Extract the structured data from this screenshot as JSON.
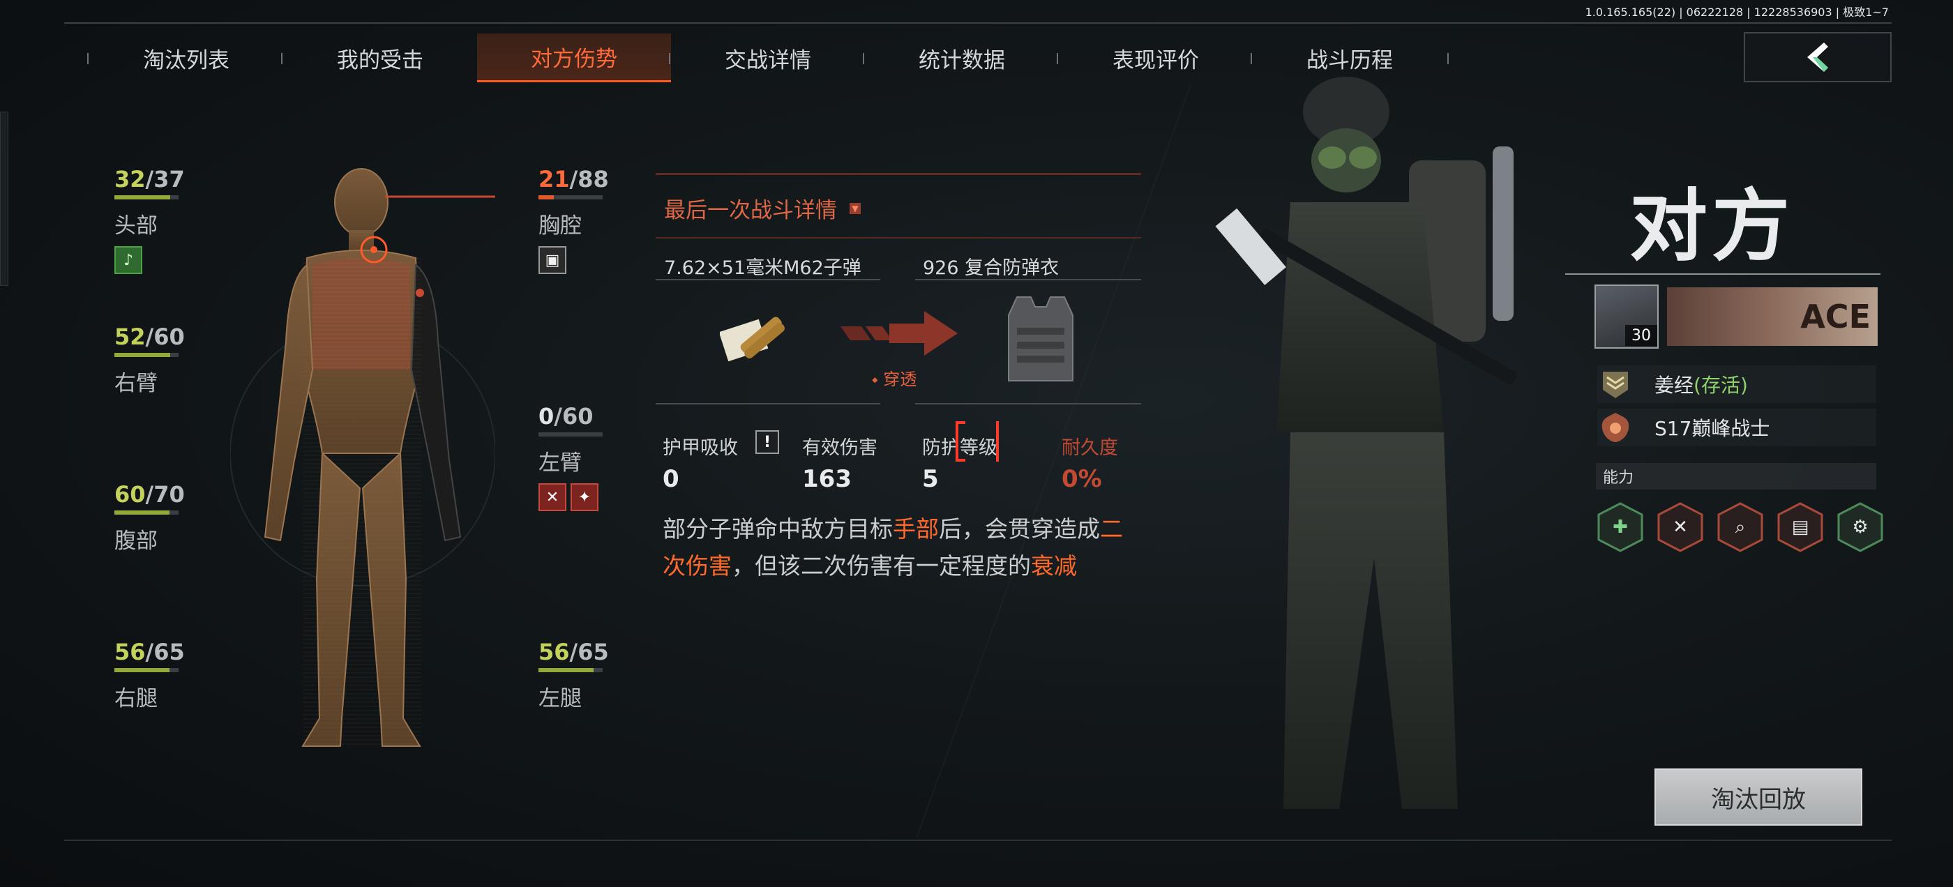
{
  "version": "1.0.165.165(22) | 06222128 | 12228536903 | 极致1~7",
  "tabs": [
    {
      "label": "淘汰列表",
      "active": false
    },
    {
      "label": "我的受击",
      "active": false
    },
    {
      "label": "对方伤势",
      "active": true
    },
    {
      "label": "交战详情",
      "active": false
    },
    {
      "label": "统计数据",
      "active": false
    },
    {
      "label": "表现评价",
      "active": false
    },
    {
      "label": "战斗历程",
      "active": false
    }
  ],
  "body_parts": {
    "head": {
      "current": "32",
      "max": "/37",
      "name": "头部",
      "fraction": 0.865
    },
    "chest": {
      "current": "21",
      "max": "/88",
      "name": "胸腔",
      "fraction": 0.239
    },
    "right_arm": {
      "current": "52",
      "max": "/60",
      "name": "右臂",
      "fraction": 0.867
    },
    "left_arm": {
      "current": "0",
      "max": "/60",
      "name": "左臂",
      "fraction": 0.0
    },
    "abdomen": {
      "current": "60",
      "max": "/70",
      "name": "腹部",
      "fraction": 0.857
    },
    "right_leg": {
      "current": "56",
      "max": "/65",
      "name": "右腿",
      "fraction": 0.862
    },
    "left_leg": {
      "current": "56",
      "max": "/65",
      "name": "左腿",
      "fraction": 0.862
    }
  },
  "fight": {
    "title": "最后一次战斗详情",
    "bullet": "7.62×51毫米M62子弹",
    "armor": "926 复合防弹衣",
    "penetrate": "穿透",
    "stats": [
      {
        "label": "护甲吸收",
        "value": "0"
      },
      {
        "label": "有效伤害",
        "value": "163"
      },
      {
        "label": "防护等级",
        "value": "5"
      },
      {
        "label": "耐久度",
        "value": "0%"
      }
    ],
    "desc_parts": [
      "部分子弹命中敌方目标",
      "手部",
      "后，会贯穿造成",
      "二次伤害",
      "，但该二次伤害有一定程度的",
      "衰减"
    ]
  },
  "opponent": {
    "title": "对方",
    "level": "30",
    "banner_text": "ACE",
    "name": "姜经",
    "status": "(存活)",
    "rank": "S17巅峰战士",
    "ability_label": "能力"
  },
  "replay_label": "淘汰回放",
  "colors": {
    "accent": "#ff6a3a",
    "hp_green": "#c4d25c",
    "alive_green": "#8fd16b"
  }
}
